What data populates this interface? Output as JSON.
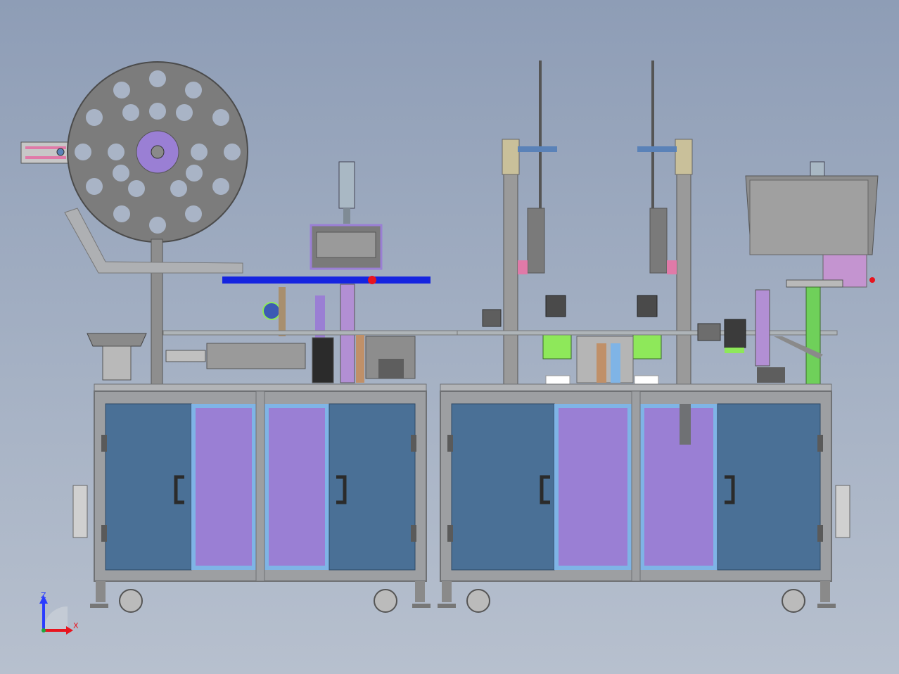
{
  "viewport": {
    "background_top": "#8e9db6",
    "background_bottom": "#b7c0ce"
  },
  "axes": {
    "z_label": "Z",
    "x_label": "X",
    "z_color": "#2a3cff",
    "x_color": "#e8141e",
    "y_color": "#1fa83a"
  },
  "colors": {
    "frame": "#9d9fa2",
    "frame_dark": "#6f7174",
    "door_blue": "#4a7096",
    "door_purple": "#9a7fd4",
    "door_trim": "#7fb4e6",
    "part_gray": "#b0b0b0",
    "accent_green": "#8ee85a",
    "accent_pink": "#e07aa8",
    "label_blue": "#1524e0"
  },
  "icons": {
    "axis_triad": "axis-triad-icon",
    "reel": "tape-reel-icon",
    "caster": "caster-wheel-icon",
    "handle": "door-handle-icon"
  }
}
